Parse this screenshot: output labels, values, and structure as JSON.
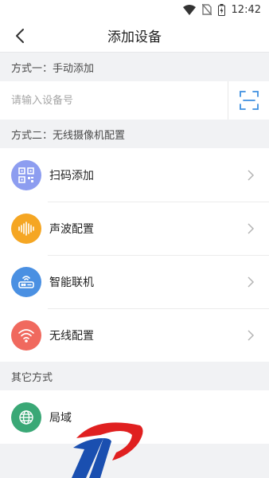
{
  "status_bar": {
    "time": "12:42",
    "icons": [
      "wifi-icon",
      "no-sim-icon",
      "battery-icon"
    ]
  },
  "header": {
    "title": "添加设备",
    "back_icon": "chevron-left-icon"
  },
  "section_manual": {
    "label": "方式一：手动添加",
    "input_placeholder": "请输入设备号",
    "input_value": "",
    "scan_icon": "scan-frame-icon"
  },
  "section_wireless": {
    "label": "方式二：无线摄像机配置",
    "items": [
      {
        "label": "扫码添加",
        "icon": "qr-code-icon",
        "color": "#8d9df0"
      },
      {
        "label": "声波配置",
        "icon": "sound-wave-icon",
        "color": "#f5a623"
      },
      {
        "label": "智能联机",
        "icon": "router-icon",
        "color": "#4a90e2"
      },
      {
        "label": "无线配置",
        "icon": "wifi-icon",
        "color": "#f0695e"
      }
    ]
  },
  "section_other": {
    "label": "其它方式",
    "items": [
      {
        "label": "局域",
        "icon": "globe-icon",
        "color": "#3aa876"
      }
    ]
  },
  "watermark": {
    "icon": "logo-watermark-icon",
    "colors": [
      "#e02020",
      "#1a4fb0"
    ]
  }
}
